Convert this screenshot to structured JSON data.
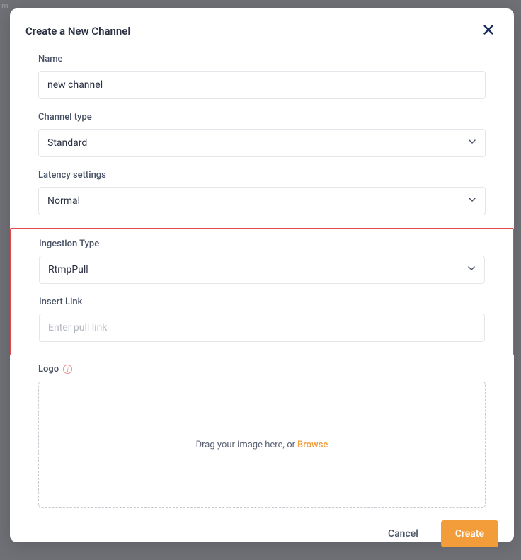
{
  "backdrop": "m",
  "modal": {
    "title": "Create a New Channel",
    "fields": {
      "name": {
        "label": "Name",
        "value": "new channel"
      },
      "channel_type": {
        "label": "Channel type",
        "value": "Standard"
      },
      "latency": {
        "label": "Latency settings",
        "value": "Normal"
      },
      "ingestion": {
        "label": "Ingestion Type",
        "value": "RtmpPull"
      },
      "insert_link": {
        "label": "Insert Link",
        "placeholder": "Enter pull link",
        "value": ""
      },
      "logo": {
        "label": "Logo",
        "drop_text": "Drag your image here, or",
        "browse": "Browse"
      }
    },
    "footer": {
      "cancel": "Cancel",
      "create": "Create"
    }
  }
}
